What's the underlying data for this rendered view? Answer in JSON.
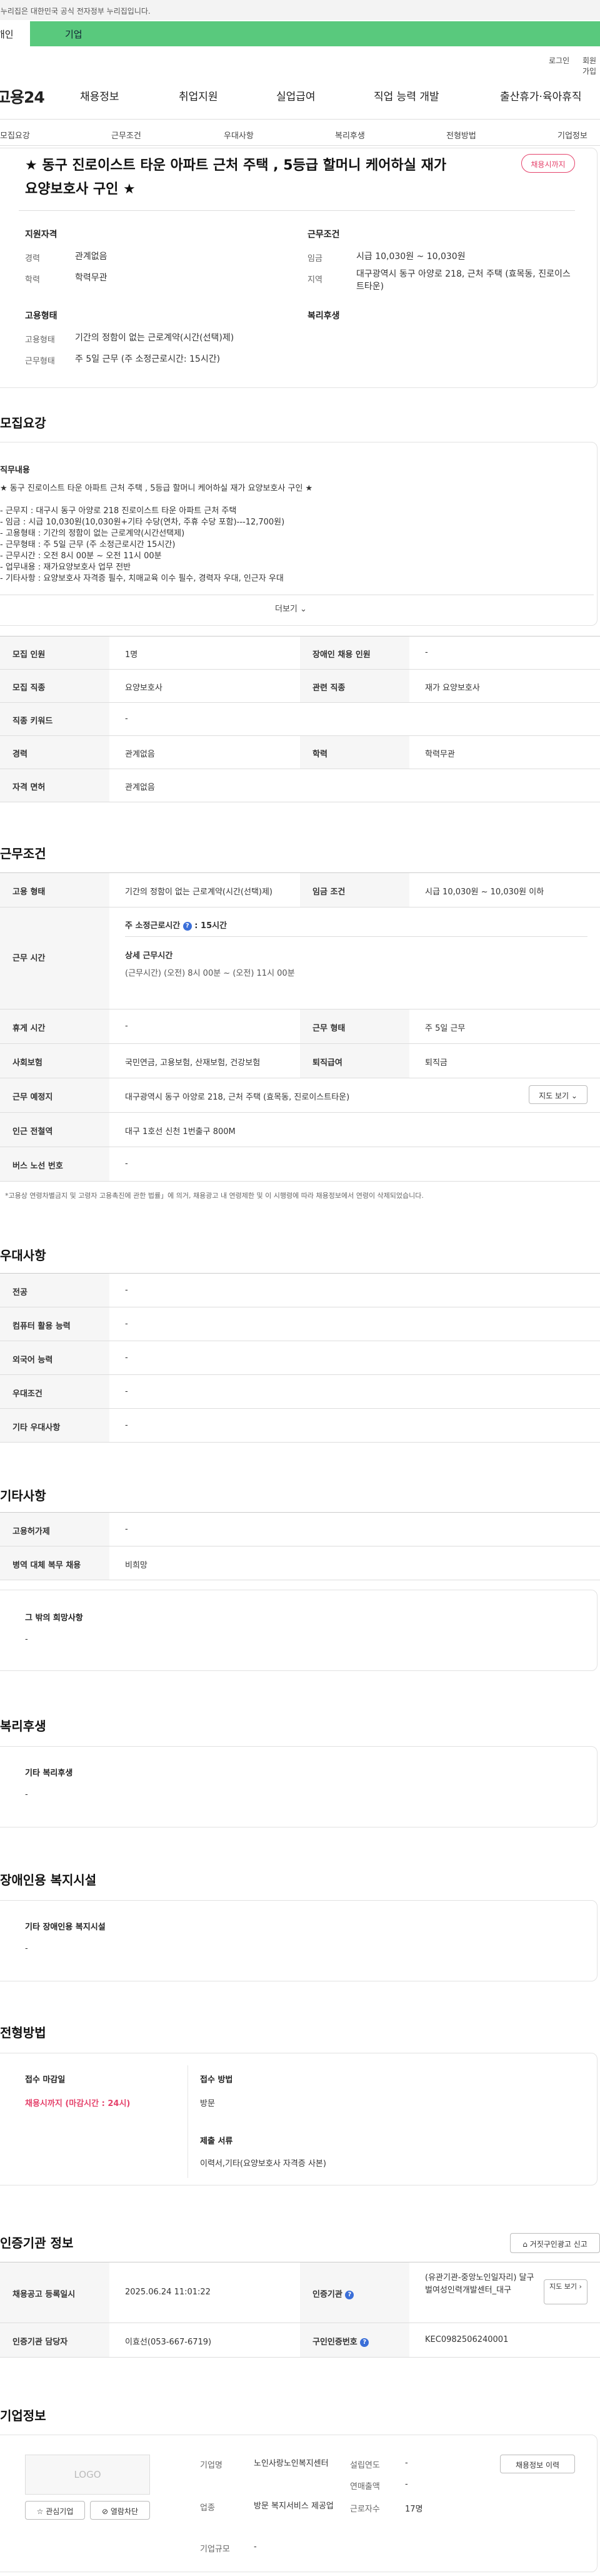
{
  "gov_banner": "이 누리집은 대한민국 공식 전자정부 누리집입니다.",
  "top_tabs": {
    "a": "개인",
    "b": "기업"
  },
  "util": {
    "login": "로그인",
    "join": "회원가입"
  },
  "logo": "고용24",
  "gnb": [
    "채용정보",
    "취업지원",
    "실업급여",
    "직업 능력 개발",
    "출산휴가·육아휴직"
  ],
  "anchors": [
    "모집요강",
    "근무조건",
    "우대사항",
    "복리후생",
    "전형방법",
    "기업정보"
  ],
  "title": "★ 동구 진로이스트 타운 아파트 근처 주택 , 5등급 할머니 케어하실 재가 요양보호사 구인 ★",
  "badge": "채용시까지",
  "summary": {
    "qual_h": "지원자격",
    "cond_h": "근무조건",
    "career_l": "경력",
    "career_v": "관계없음",
    "edu_l": "학력",
    "edu_v": "학력무관",
    "wage_l": "임금",
    "wage_v": "시급 10,030원 ~ 10,030원",
    "region_l": "지역",
    "region_v": "대구광역시 동구 아양로 218, 근처 주택 (효목동, 진로이스트타운)",
    "emp_h": "고용형태",
    "welfare_h": "복리후생",
    "emptype_l": "고용형태",
    "emptype_v": "기간의 정함이 없는 근로계약(시간(선택)제)",
    "worktype_l": "근무형태",
    "worktype_v": "주 5일 근무 (주 소정근로시간: 15시간)"
  },
  "recruit": {
    "heading": "모집요강",
    "duty_h": "직무내용",
    "duty_lines": [
      "★ 동구 진로이스트 타운 아파트 근처 주택 , 5등급 할머니 케어하실 재가 요양보호사 구인 ★",
      "",
      "- 근무지 : 대구시 동구 아양로 218 진로이스트 타운 아파트 근처 주택",
      "- 임금 : 시급 10,030원(10,030원+기타 수당(연차, 주휴 수당 포함)---12,700원)",
      "- 고용형태 : 기간의 정함이 없는 근로계약(시간선택제)",
      "- 근무형태 : 주 5일 근무 (주 소정근로시간 15시간)",
      "- 근무시간 : 오전 8시 00분 ~ 오전 11시 00분",
      "- 업무내용 : 재가요양보호사 업무 전반",
      "- 기타사항 : 요양보호사 자격증 필수, 치매교육 이수 필수, 경력자 우대, 인근자 우대"
    ],
    "more": "더보기",
    "rows": [
      {
        "l1": "모집 인원",
        "v1": "1명",
        "l2": "장애인 채용 인원",
        "v2": "-"
      },
      {
        "l1": "모집 직종",
        "v1": "요양보호사",
        "l2": "관련 직종",
        "v2": "재가 요양보호사"
      },
      {
        "l1": "직종 키워드",
        "v1": "-"
      },
      {
        "l1": "경력",
        "v1": "관계없음",
        "l2": "학력",
        "v2": "학력무관"
      },
      {
        "l1": "자격 면허",
        "v1": "관계없음"
      }
    ]
  },
  "cond": {
    "heading": "근무조건",
    "r1": {
      "l1": "고용 형태",
      "v1": "기간의 정함이 없는 근로계약(시간(선택)제)",
      "l2": "임금 조건",
      "v2": "시급 10,030원 ~ 10,030원 이하"
    },
    "time_l": "근무 시간",
    "weekly_l": "주 소정근로시간",
    "weekly_v": "15시간",
    "detail_l": "상세 근무시간",
    "detail_v": "(근무시간) (오전) 8시 00분 ~ (오전) 11시 00분",
    "r2": {
      "l1": "휴게 시간",
      "v1": "-",
      "l2": "근무 형태",
      "v2": "주 5일 근무"
    },
    "r3": {
      "l1": "사회보험",
      "v1": "국민연금, 고용보험, 산재보험, 건강보험",
      "l2": "퇴직급여",
      "v2": "퇴직금"
    },
    "r4": {
      "l1": "근무 예정지",
      "v1": "대구광역시 동구 아양로 218, 근처 주택 (효목동, 진로이스트타운)",
      "btn": "지도 보기"
    },
    "r5": {
      "l1": "인근 전철역",
      "v1": "대구 1호선 신천 1번출구 800M"
    },
    "r6": {
      "l1": "버스 노선 번호",
      "v1": "-"
    },
    "note": "*고용상 연령차별금지 및 고령자 고용촉진에 관한 법률」에 의거, 채용광고 내 연령제한 및 이 시행령에 따라 채용정보에서 연령이 삭제되었습니다."
  },
  "pref": {
    "heading": "우대사항",
    "rows": [
      {
        "l": "전공",
        "v": "-"
      },
      {
        "l": "컴퓨터 활용 능력",
        "v": "-"
      },
      {
        "l": "외국어 능력",
        "v": "-"
      },
      {
        "l": "우대조건",
        "v": "-"
      },
      {
        "l": "기타 우대사항",
        "v": "-"
      }
    ]
  },
  "etc": {
    "heading": "기타사항",
    "rows": [
      {
        "l": "고용허가제",
        "v": "-"
      },
      {
        "l": "병역 대체 복무 채용",
        "v": "비희망"
      }
    ],
    "box_h": "그 밖의 희망사항",
    "box_v": "-"
  },
  "welfare": {
    "heading": "복리후생",
    "box_h": "기타 복리후생",
    "box_v": "-"
  },
  "disab": {
    "heading": "장애인용 복지시설",
    "box_h": "기타 장애인용 복지시설",
    "box_v": "-"
  },
  "process": {
    "heading": "전형방법",
    "deadline_h": "접수 마감일",
    "deadline_v": "채용시까지 (마감시간 : 24시)",
    "method_h": "접수 방법",
    "method_v": "방문",
    "docs_h": "제출 서류",
    "docs_v": "이력서,기타(요양보호사 자격증 사본)"
  },
  "cert": {
    "heading": "인증기관 정보",
    "report_btn": "거짓구인광고 신고",
    "reg_l": "채용공고 등록일시",
    "reg_v": "2025.06.24 11:01:22",
    "org_l": "인증기관",
    "org_v": "(유관기관-중앙노인일자리) 달구벌여성인력개발센터_대구",
    "org_btn": "지도 보기",
    "mgr_l": "인증기관 담당자",
    "mgr_v": "이효선(053-667-6719)",
    "no_l": "구인인증번호",
    "no_v": "KEC0982506240001"
  },
  "company": {
    "heading": "기업정보",
    "logo": "LOGO",
    "fav_btn": "관심기업",
    "alert_btn": "열람차단",
    "name_l": "기업명",
    "name_v": "노인사랑노인복지센터",
    "year_l": "설립연도",
    "year_v": "-",
    "sales_l": "연매출액",
    "sales_v": "-",
    "ind_l": "업종",
    "ind_v": "방문 복지서비스 제공업",
    "emp_l": "근로자수",
    "emp_v": "17명",
    "size_l": "기업규모",
    "size_v": "-",
    "jobs_btn": "채용정보 이력"
  }
}
